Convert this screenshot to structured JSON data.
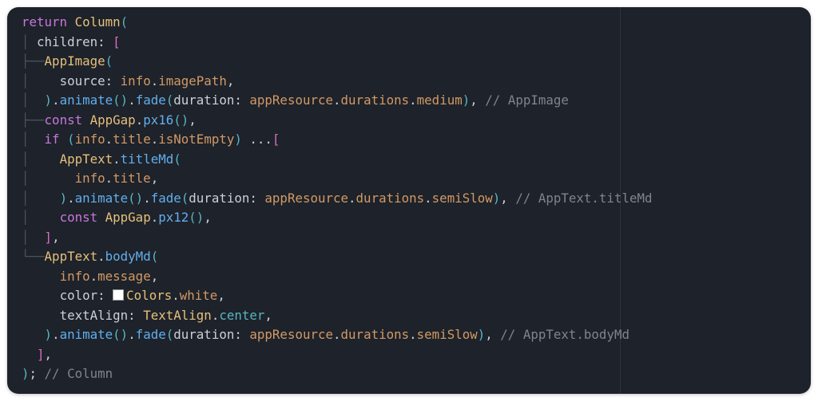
{
  "editor": {
    "lines": [
      [
        {
          "t": "return",
          "c": "c-return"
        },
        {
          "t": " "
        },
        {
          "t": "Column",
          "c": "c-class"
        },
        {
          "t": "(",
          "c": "c-paren"
        }
      ],
      [
        {
          "t": "│ ",
          "c": "ind"
        },
        {
          "t": "children",
          "c": "c-param"
        },
        {
          "t": ": "
        },
        {
          "t": "[",
          "c": "c-bracket"
        }
      ],
      [
        {
          "t": "├──",
          "c": "ind"
        },
        {
          "t": "AppImage",
          "c": "c-class"
        },
        {
          "t": "(",
          "c": "c-paren"
        }
      ],
      [
        {
          "t": "│    ",
          "c": "ind"
        },
        {
          "t": "source",
          "c": "c-param"
        },
        {
          "t": ": "
        },
        {
          "t": "info",
          "c": "c-prop"
        },
        {
          "t": "."
        },
        {
          "t": "imagePath",
          "c": "c-prop"
        },
        {
          "t": ","
        }
      ],
      [
        {
          "t": "│  ",
          "c": "ind"
        },
        {
          "t": ")",
          "c": "c-paren"
        },
        {
          "t": "."
        },
        {
          "t": "animate",
          "c": "c-fn"
        },
        {
          "t": "()",
          "c": "c-paren"
        },
        {
          "t": "."
        },
        {
          "t": "fade",
          "c": "c-fn"
        },
        {
          "t": "(",
          "c": "c-paren"
        },
        {
          "t": "duration",
          "c": "c-param"
        },
        {
          "t": ": "
        },
        {
          "t": "appResource",
          "c": "c-prop"
        },
        {
          "t": "."
        },
        {
          "t": "durations",
          "c": "c-prop"
        },
        {
          "t": "."
        },
        {
          "t": "medium",
          "c": "c-prop"
        },
        {
          "t": ")",
          "c": "c-paren"
        },
        {
          "t": ", "
        },
        {
          "t": "// AppImage",
          "c": "c-comment"
        }
      ],
      [
        {
          "t": "├──",
          "c": "ind"
        },
        {
          "t": "const",
          "c": "c-const"
        },
        {
          "t": " "
        },
        {
          "t": "AppGap",
          "c": "c-class"
        },
        {
          "t": "."
        },
        {
          "t": "px16",
          "c": "c-fn"
        },
        {
          "t": "()",
          "c": "c-paren"
        },
        {
          "t": ","
        }
      ],
      [
        {
          "t": "│  ",
          "c": "ind"
        },
        {
          "t": "if",
          "c": "c-if"
        },
        {
          "t": " "
        },
        {
          "t": "(",
          "c": "c-paren"
        },
        {
          "t": "info",
          "c": "c-prop"
        },
        {
          "t": "."
        },
        {
          "t": "title",
          "c": "c-prop"
        },
        {
          "t": "."
        },
        {
          "t": "isNotEmpty",
          "c": "c-prop"
        },
        {
          "t": ")",
          "c": "c-paren"
        },
        {
          "t": " ..."
        },
        {
          "t": "[",
          "c": "c-bracket"
        }
      ],
      [
        {
          "t": "│    ",
          "c": "ind"
        },
        {
          "t": "AppText",
          "c": "c-class"
        },
        {
          "t": "."
        },
        {
          "t": "titleMd",
          "c": "c-fn"
        },
        {
          "t": "(",
          "c": "c-paren"
        }
      ],
      [
        {
          "t": "│      ",
          "c": "ind"
        },
        {
          "t": "info",
          "c": "c-prop"
        },
        {
          "t": "."
        },
        {
          "t": "title",
          "c": "c-prop"
        },
        {
          "t": ","
        }
      ],
      [
        {
          "t": "│    ",
          "c": "ind"
        },
        {
          "t": ")",
          "c": "c-paren"
        },
        {
          "t": "."
        },
        {
          "t": "animate",
          "c": "c-fn"
        },
        {
          "t": "()",
          "c": "c-paren"
        },
        {
          "t": "."
        },
        {
          "t": "fade",
          "c": "c-fn"
        },
        {
          "t": "(",
          "c": "c-paren"
        },
        {
          "t": "duration",
          "c": "c-param"
        },
        {
          "t": ": "
        },
        {
          "t": "appResource",
          "c": "c-prop"
        },
        {
          "t": "."
        },
        {
          "t": "durations",
          "c": "c-prop"
        },
        {
          "t": "."
        },
        {
          "t": "semiSlow",
          "c": "c-prop"
        },
        {
          "t": ")",
          "c": "c-paren"
        },
        {
          "t": ", "
        },
        {
          "t": "// AppText.titleMd",
          "c": "c-comment"
        }
      ],
      [
        {
          "t": "│    ",
          "c": "ind"
        },
        {
          "t": "const",
          "c": "c-const"
        },
        {
          "t": " "
        },
        {
          "t": "AppGap",
          "c": "c-class"
        },
        {
          "t": "."
        },
        {
          "t": "px12",
          "c": "c-fn"
        },
        {
          "t": "()",
          "c": "c-paren"
        },
        {
          "t": ","
        }
      ],
      [
        {
          "t": "│  ",
          "c": "ind"
        },
        {
          "t": "]",
          "c": "c-bracket"
        },
        {
          "t": ","
        }
      ],
      [
        {
          "t": "└──",
          "c": "ind"
        },
        {
          "t": "AppText",
          "c": "c-class"
        },
        {
          "t": "."
        },
        {
          "t": "bodyMd",
          "c": "c-fn"
        },
        {
          "t": "(",
          "c": "c-paren"
        }
      ],
      [
        {
          "t": "     "
        },
        {
          "t": "info",
          "c": "c-prop"
        },
        {
          "t": "."
        },
        {
          "t": "message",
          "c": "c-prop"
        },
        {
          "t": ","
        }
      ],
      [
        {
          "t": "     "
        },
        {
          "t": "color",
          "c": "c-param"
        },
        {
          "t": ": "
        },
        {
          "swatch": true
        },
        {
          "t": "Colors",
          "c": "c-class"
        },
        {
          "t": "."
        },
        {
          "t": "white",
          "c": "c-prop"
        },
        {
          "t": ","
        }
      ],
      [
        {
          "t": "     "
        },
        {
          "t": "textAlign",
          "c": "c-param"
        },
        {
          "t": ": "
        },
        {
          "t": "TextAlign",
          "c": "c-class"
        },
        {
          "t": "."
        },
        {
          "t": "center",
          "c": "c-enum"
        },
        {
          "t": ","
        }
      ],
      [
        {
          "t": "   "
        },
        {
          "t": ")",
          "c": "c-paren"
        },
        {
          "t": "."
        },
        {
          "t": "animate",
          "c": "c-fn"
        },
        {
          "t": "()",
          "c": "c-paren"
        },
        {
          "t": "."
        },
        {
          "t": "fade",
          "c": "c-fn"
        },
        {
          "t": "(",
          "c": "c-paren"
        },
        {
          "t": "duration",
          "c": "c-param"
        },
        {
          "t": ": "
        },
        {
          "t": "appResource",
          "c": "c-prop"
        },
        {
          "t": "."
        },
        {
          "t": "durations",
          "c": "c-prop"
        },
        {
          "t": "."
        },
        {
          "t": "semiSlow",
          "c": "c-prop"
        },
        {
          "t": ")",
          "c": "c-paren"
        },
        {
          "t": ", "
        },
        {
          "t": "// AppText.bodyMd",
          "c": "c-comment"
        }
      ],
      [
        {
          "t": "  "
        },
        {
          "t": "]",
          "c": "c-bracket"
        },
        {
          "t": ","
        }
      ],
      [
        {
          "t": ")",
          "c": "c-paren"
        },
        {
          "t": "; "
        },
        {
          "t": "// Column",
          "c": "c-comment"
        }
      ]
    ]
  },
  "colors": {
    "background": "#1e222a",
    "keyword": "#c678dd",
    "class": "#e5c07b",
    "function": "#61afef",
    "property": "#d19a66",
    "comment": "#7f848e",
    "paren": "#56b6c2",
    "bracket": "#d66ec2",
    "swatch": "#ffffff"
  }
}
